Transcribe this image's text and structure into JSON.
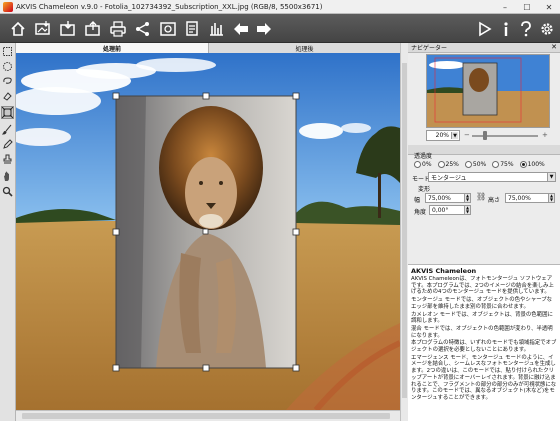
{
  "window": {
    "title": "AKVIS Chameleon v.9.0 - Fotolia_102734392_Subscription_XXL.jpg (RGB/8, 5500x3671)",
    "minimize_glyph": "–",
    "maximize_glyph": "☐",
    "close_glyph": "✕"
  },
  "toolbar": {
    "left_icons": [
      "home-icon",
      "open-image-icon",
      "save-image-icon",
      "upload-icon",
      "print-icon",
      "share-icon",
      "image-adjust-icon",
      "settings-doc-icon",
      "chart-icon",
      "undo-arrow-icon",
      "redo-arrow-icon"
    ],
    "right_icons": [
      "run-play-icon",
      "info-icon",
      "help-icon",
      "gear-icon"
    ]
  },
  "tools": [
    "rect-select-icon",
    "ellipse-select-icon",
    "lasso-icon",
    "eraser-icon",
    "transform-icon",
    "brush-icon",
    "pencil-icon",
    "stamp-icon",
    "hand-icon",
    "zoom-icon"
  ],
  "tabs": {
    "before": "処理前",
    "after": "処理後"
  },
  "navigator": {
    "title": "ナビゲーター",
    "close_glyph": "✕",
    "zoom_value": "20%",
    "zoom_level": 0.2,
    "minus_glyph": "−",
    "plus_glyph": "+"
  },
  "transparency": {
    "label": "透過度",
    "options": [
      "0%",
      "25%",
      "50%",
      "75%",
      "100%"
    ],
    "selected": "100%"
  },
  "mode": {
    "label": "モード",
    "value": "モンタージュ"
  },
  "transform": {
    "label": "変形",
    "width_label": "幅",
    "width_value": "75,00%",
    "height_label": "高さ",
    "height_value": "75,00%",
    "angle_label": "角度",
    "angle_value": "0,00°"
  },
  "help": {
    "title": "AKVIS Chameleon",
    "paragraphs": [
      "AKVIS Chameleonは、フォトモンタージュ ソフトウェアです。本プログラムでは、2つのイメージの結合を楽しみ上げるための4つのモンタージュ モードを提供しています。",
      "モンタージュ モードでは、オブジェクトの色やシャープなエッジ部を維持したまま別の背景に合わせます。",
      "カメレオン モードでは、オブジェクトは、背景の色範囲に調和します。",
      "混合 モードでは、オブジェクトの色範囲が変わり、半透明になります。",
      "本プログラムの特徴は、いずれのモードでも領域指定でオブジェクトの選択を必要としないことにあります。",
      "エマージェンス モード、モンタージュ モードのように、イメージを結合し、シームレスなフォトモンタージュを生成します。2つの違いは、このモードでは、貼り付けられたクリップアートが背景にオーバーレイされます。背景に融け込まれることで、フラグメントの部分の部分のみが可視状態になります。このモードでは、異なるオブジェクト(木など)をモンタージュすることができます。"
    ]
  }
}
